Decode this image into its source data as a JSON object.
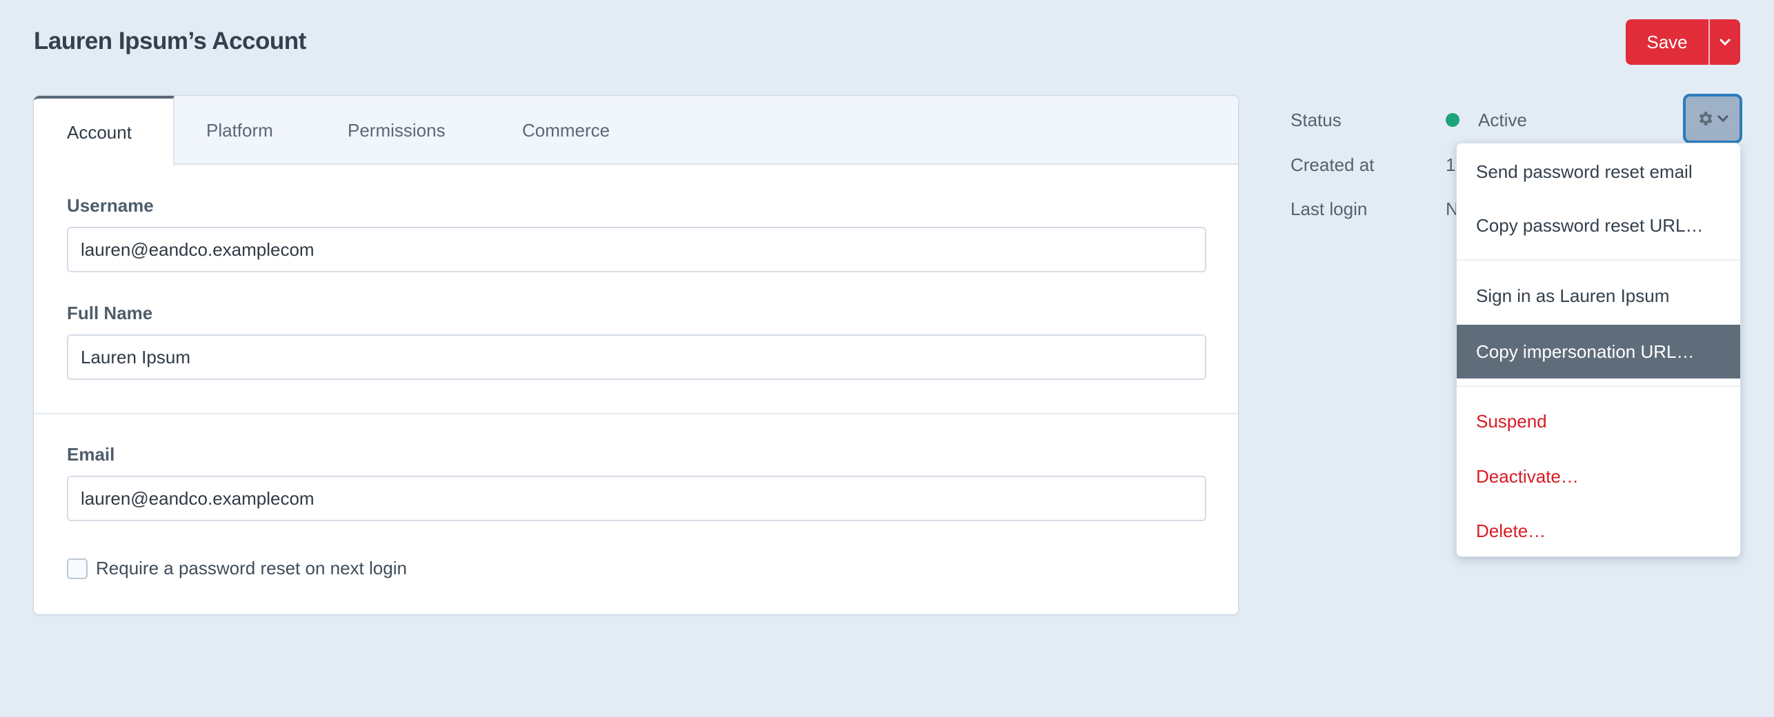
{
  "header": {
    "title": "Lauren Ipsum’s Account",
    "save_label": "Save"
  },
  "tabs": [
    {
      "label": "Account",
      "active": true
    },
    {
      "label": "Platform"
    },
    {
      "label": "Permissions"
    },
    {
      "label": "Commerce"
    }
  ],
  "form": {
    "username": {
      "label": "Username",
      "value": "lauren@eandco.examplecom"
    },
    "full_name": {
      "label": "Full Name",
      "value": "Lauren Ipsum"
    },
    "email": {
      "label": "Email",
      "value": "lauren@eandco.examplecom"
    },
    "require_reset": {
      "label": "Require a password reset on next login",
      "checked": false
    }
  },
  "meta": {
    "status": {
      "label": "Status",
      "value": "Active",
      "color": "#1ea37a"
    },
    "created_at": {
      "label": "Created at",
      "value": "1"
    },
    "last_login": {
      "label": "Last login",
      "value": "N"
    }
  },
  "actions_menu": {
    "icon": "gear-icon",
    "items": [
      {
        "label": "Send password reset email"
      },
      {
        "label": "Copy password reset URL…"
      },
      {
        "label": "Sign in as Lauren Ipsum"
      },
      {
        "label": "Copy impersonation URL…",
        "highlighted": true
      },
      {
        "label": "Suspend",
        "danger": true
      },
      {
        "label": "Deactivate…",
        "danger": true
      },
      {
        "label": "Delete…",
        "danger": true
      }
    ]
  },
  "colors": {
    "accent": "#e12d39",
    "danger": "#d91a24",
    "highlight": "#5f6d7b",
    "focus": "#2a7dbd"
  }
}
